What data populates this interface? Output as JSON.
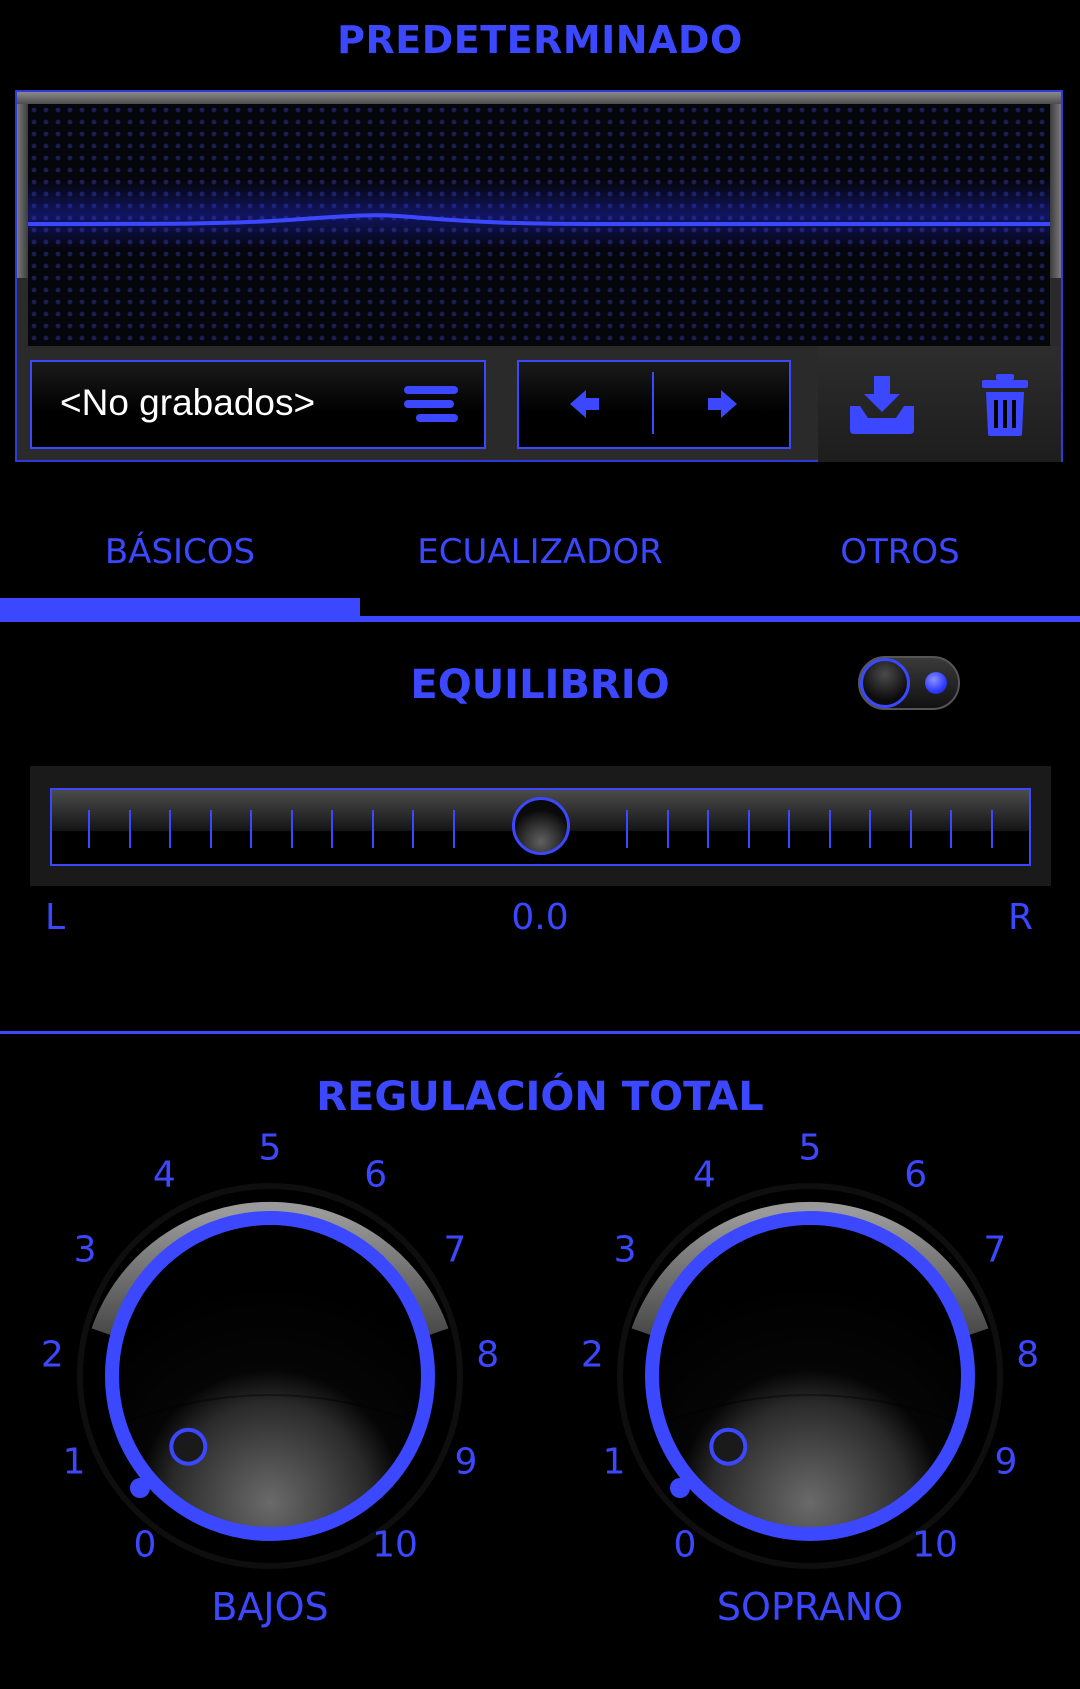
{
  "header": {
    "title": "PREDETERMINADO"
  },
  "preset": {
    "current": "<No grabados>"
  },
  "tabs": [
    {
      "label": "BÁSICOS",
      "active": true
    },
    {
      "label": "ECUALIZADOR"
    },
    {
      "label": "OTROS"
    }
  ],
  "balance": {
    "title": "EQUILIBRIO",
    "enabled": true,
    "left_label": "L",
    "right_label": "R",
    "value": "0.0",
    "position": 0.5
  },
  "regulation": {
    "title": "REGULACIÓN TOTAL",
    "knobs": [
      {
        "label": "BAJOS",
        "value": 0
      },
      {
        "label": "SOPRANO",
        "value": 0
      }
    ],
    "scale": [
      "0",
      "1",
      "2",
      "3",
      "4",
      "5",
      "6",
      "7",
      "8",
      "9",
      "10"
    ]
  },
  "icons": {
    "menu": "list-menu-icon",
    "prev": "arrow-left-icon",
    "next": "arrow-right-icon",
    "save": "download-save-icon",
    "delete": "trash-icon"
  },
  "colors": {
    "accent": "#3b48ff",
    "background": "#000000"
  }
}
